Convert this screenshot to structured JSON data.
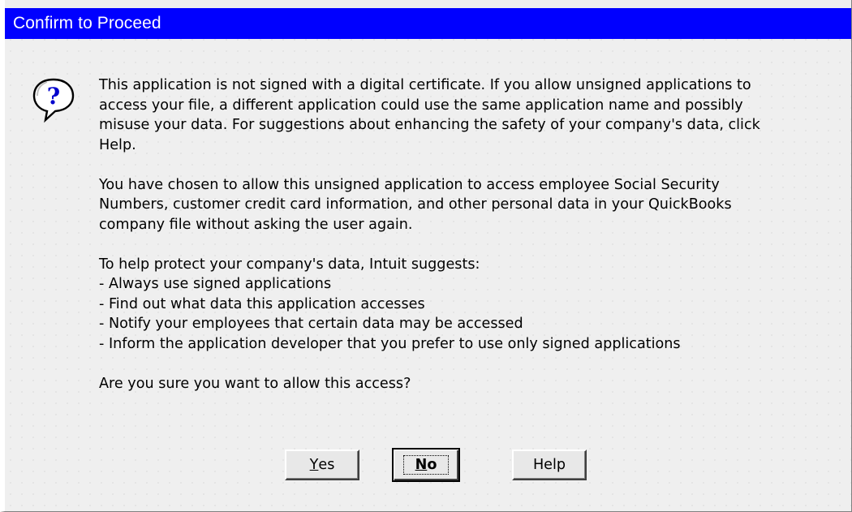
{
  "window": {
    "title": "Confirm to Proceed"
  },
  "icon": "question-balloon-icon",
  "message": {
    "p1": [
      "This application is not signed with a digital certificate.  If you allow unsigned applications to",
      "access your file, a different application could use the same application name and possibly",
      "misuse your data.  For suggestions about enhancing the safety of your company's data, click",
      "Help."
    ],
    "p2": [
      "You have chosen to allow this unsigned application to access employee Social Security",
      "Numbers, customer credit card information, and other personal data in your QuickBooks",
      "company file without asking the user again."
    ],
    "p3_heading": "To help protect your company's data, Intuit suggests:",
    "suggestions": [
      "-  Always use signed applications",
      "-  Find out what data this application accesses",
      "-  Notify your employees that certain data may be accessed",
      "-  Inform the application developer that you prefer to use only signed applications"
    ],
    "question": "Are you sure you want to allow this access?"
  },
  "buttons": {
    "yes_mnemonic": "Y",
    "yes_rest": "es",
    "no_mnemonic": "N",
    "no_rest": "o",
    "help": "Help"
  },
  "colors": {
    "titlebar": "#0000ff",
    "background": "#efefef"
  }
}
